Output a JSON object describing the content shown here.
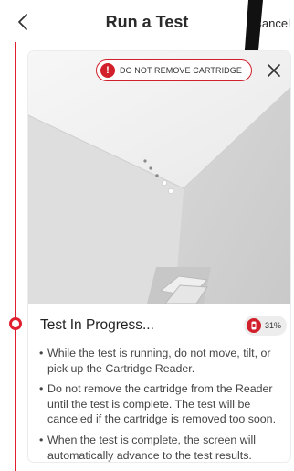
{
  "header": {
    "title": "Run a Test",
    "cancel_label": "Cancel"
  },
  "warning": {
    "icon_glyph": "!",
    "text": "DO NOT REMOVE CARTRIDGE"
  },
  "status": {
    "title": "Test In Progress...",
    "progress_label": "31%",
    "progress": 0.31
  },
  "instructions": [
    "While the test is running, do not move, tilt, or pick up the Cartridge Reader.",
    "Do not remove the cartridge from the Reader until the test is complete. The test will be canceled if the cartridge is removed too soon.",
    "When the test is complete, the screen will automatically advance to the test results."
  ],
  "colors": {
    "accent": "#d1202b",
    "timeline": "#e0202e"
  }
}
